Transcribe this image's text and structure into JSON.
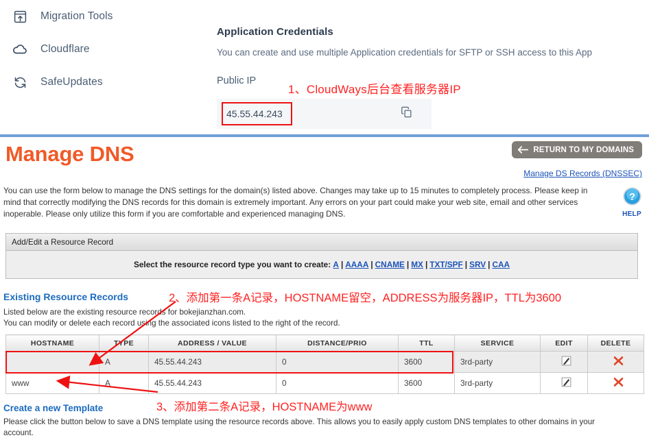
{
  "cloudways": {
    "nav": [
      {
        "label": "Migration Tools",
        "icon": "migration-tools-icon"
      },
      {
        "label": "Cloudflare",
        "icon": "cloud-icon"
      },
      {
        "label": "SafeUpdates",
        "icon": "refresh-icon"
      }
    ],
    "credentials_title": "Application Credentials",
    "credentials_subtitle": "You can create and use multiple Application credentials for SFTP or SSH access to this App",
    "public_ip_label": "Public IP",
    "public_ip_value": "45.55.44.243",
    "copy_icon": "copy-icon"
  },
  "annotations": {
    "one": "1、CloudWays后台查看服务器IP",
    "two": "2、添加第一条A记录，HOSTNAME留空，ADDRESS为服务器IP，TTL为3600",
    "three": "3、添加第二条A记录，HOSTNAME为www",
    "color": "#ff2222"
  },
  "dns": {
    "title": "Manage DNS",
    "title_color": "#f05a28",
    "return_button": "RETURN TO MY DOMAINS",
    "return_icon": "arrow-left-icon",
    "dnssec_link": "Manage DS Records (DNSSEC)",
    "intro": "You can use the form below to manage the DNS settings for the domain(s) listed above. Changes may take up to 15 minutes to completely process. Please keep in mind that correctly modifying the DNS records for this domain is extremely important. Any errors on your part could make your web site, email and other services inoperable. Please only utilize this form if you are comfortable and experienced managing DNS.",
    "help_label": "HELP",
    "help_icon": "question-mark-icon",
    "add_edit_header": "Add/Edit a Resource Record",
    "select_type_prefix": "Select the resource record type you want to create:",
    "record_types": [
      "A",
      "AAAA",
      "CNAME",
      "MX",
      "TXT/SPF",
      "SRV",
      "CAA"
    ],
    "existing_heading": "Existing Resource Records",
    "existing_desc_line1": "Listed below are the existing resource records for bokejianzhan.com.",
    "existing_desc_line2": "You can modify or delete each record using the associated icons listed to the right of the record.",
    "table": {
      "columns": [
        "HOSTNAME",
        "TYPE",
        "ADDRESS / VALUE",
        "DISTANCE/PRIO",
        "TTL",
        "SERVICE",
        "EDIT",
        "DELETE"
      ],
      "rows": [
        {
          "hostname": "",
          "type": "A",
          "address": "45.55.44.243",
          "distance": "0",
          "ttl": "3600",
          "service": "3rd-party",
          "edit_icon": "edit-pencil-icon",
          "delete_icon": "delete-x-icon"
        },
        {
          "hostname": "www",
          "type": "A",
          "address": "45.55.44.243",
          "distance": "0",
          "ttl": "3600",
          "service": "3rd-party",
          "edit_icon": "edit-pencil-icon",
          "delete_icon": "delete-x-icon"
        }
      ]
    },
    "template_heading": "Create a new Template",
    "template_desc": "Please click the button below to save a DNS template using the resource records above. This allows you to easily apply custom DNS templates to other domains in your account."
  }
}
